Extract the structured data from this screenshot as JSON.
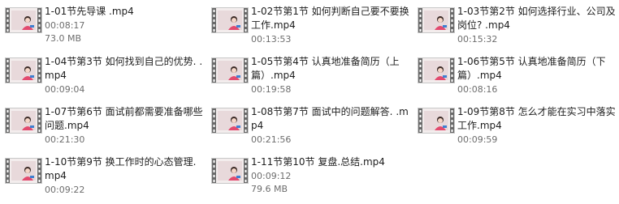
{
  "colors": {
    "film_strip": "#6a6a6a",
    "film_bg": "#f3eded",
    "film_frame": "#e8d9db",
    "figure_accent": "#e24a6e",
    "figure_hair": "#3a2a26",
    "text_primary": "#1e1e1e",
    "text_secondary": "#6d6d6d"
  },
  "files": [
    {
      "name": "1-01节先导课 .mp4",
      "duration": "00:08:17",
      "size": "73.0 MB",
      "icon": "video-file-icon"
    },
    {
      "name": "1-02节第1节 如何判断自己要不要换工作.mp4",
      "duration": "00:13:53",
      "size": "",
      "icon": "video-file-icon"
    },
    {
      "name": "1-03节第2节 如何选择行业、公司及岗位? .mp4",
      "duration": "00:15:32",
      "size": "",
      "icon": "video-file-icon"
    },
    {
      "name": "1-04节第3节 如何找到自己的优势. .mp4",
      "duration": "00:09:04",
      "size": "",
      "icon": "video-file-icon"
    },
    {
      "name": "1-05节第4节 认真地准备简历（上篇）.mp4",
      "duration": "00:19:58",
      "size": "",
      "icon": "video-file-icon"
    },
    {
      "name": "1-06节第5节 认真地准备简历（下篇）.mp4",
      "duration": "00:08:16",
      "size": "",
      "icon": "video-file-icon"
    },
    {
      "name": "1-07节第6节  面试前都需要准备哪些问题.mp4",
      "duration": "00:21:30",
      "size": "",
      "icon": "video-file-icon"
    },
    {
      "name": "1-08节第7节 面试中的问题解答. .mp4",
      "duration": "00:21:56",
      "size": "",
      "icon": "video-file-icon"
    },
    {
      "name": "1-09节第8节 怎么才能在实习中落实工作.mp4",
      "duration": "00:09:59",
      "size": "",
      "icon": "video-file-icon"
    },
    {
      "name": "1-10节第9节  换工作时的心态管理.mp4",
      "duration": "00:09:22",
      "size": "",
      "icon": "video-file-icon"
    },
    {
      "name": "1-11节第10节  复盘.总结.mp4",
      "duration": "00:09:12",
      "size": "79.6 MB",
      "icon": "video-file-icon"
    }
  ]
}
